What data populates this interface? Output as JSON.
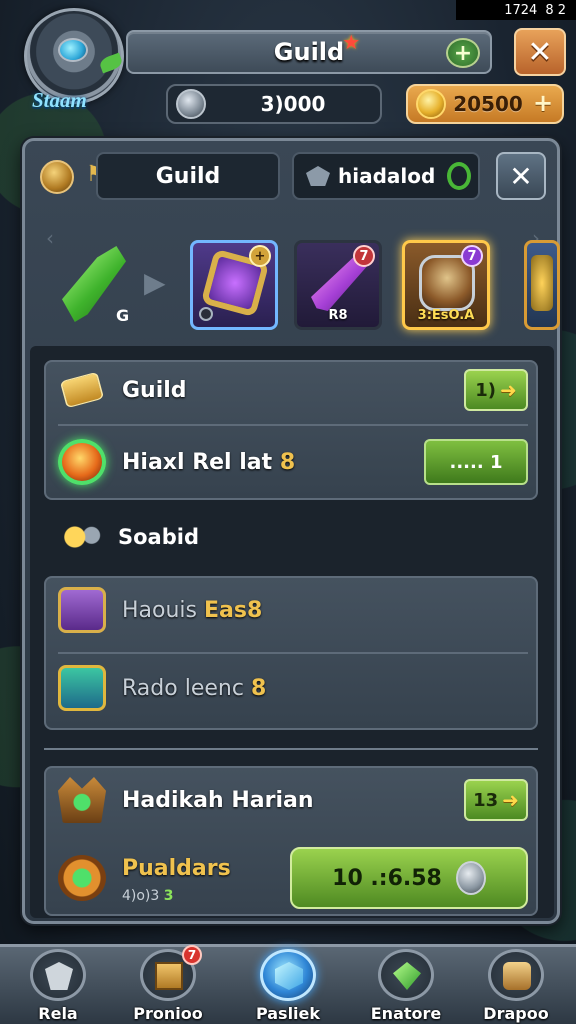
{
  "status_bar": {
    "time": "1724",
    "battery": "8 2"
  },
  "header": {
    "avatar_name": "Staam",
    "title": "Guild",
    "title_badge": "★",
    "plus": "+",
    "close": "✕",
    "currency_left": "3)000",
    "currency_right": "20500",
    "currency_plus": "+"
  },
  "tabs": {
    "guild_label": "Guild",
    "other_label": "hiadalod",
    "close": "✕"
  },
  "carousel": {
    "prev": "‹",
    "next": "›",
    "feature_label": "G",
    "arrow": "▶",
    "cards": [
      {
        "badge": "",
        "label": "",
        "accent": "#73b7ff"
      },
      {
        "badge": "7",
        "label": "R8",
        "accent": "#2c3440"
      },
      {
        "badge": "7",
        "label": "3:EsO.A",
        "accent": "#ffc94a"
      },
      {
        "badge": "",
        "label": "",
        "accent": "#d89b35"
      }
    ]
  },
  "group_a": {
    "row1_label": "Guild",
    "row1_button": "1)",
    "row1_arrow": "➜",
    "row2_label": "Hiaxl Rel lat",
    "row2_suffix": "8",
    "row2_button": "..... 1"
  },
  "section": {
    "title": "Soabid"
  },
  "group_b": {
    "row1_label": "Haouis",
    "row1_suffix": "Eas8",
    "row2_label": "Rado leenc",
    "row2_suffix": "8"
  },
  "group_c": {
    "row1_label": "Hadikah Harian",
    "row1_button": "13",
    "row1_arrow": "➜",
    "row2_label": "Pualdars",
    "row2_note": "4)o)3",
    "row2_note_accent": "3",
    "row2_button": "10 .:6.58"
  },
  "bottom_nav": {
    "items": [
      {
        "label": "Rela",
        "icon": "shield-icon"
      },
      {
        "label": "Pronioo",
        "icon": "crate-icon",
        "badge": "7"
      },
      {
        "label": "Pasliek",
        "icon": "cube-icon",
        "active": true
      },
      {
        "label": "Enatore",
        "icon": "gem-icon"
      },
      {
        "label": "Drapoo",
        "icon": "scroll-icon"
      }
    ]
  }
}
